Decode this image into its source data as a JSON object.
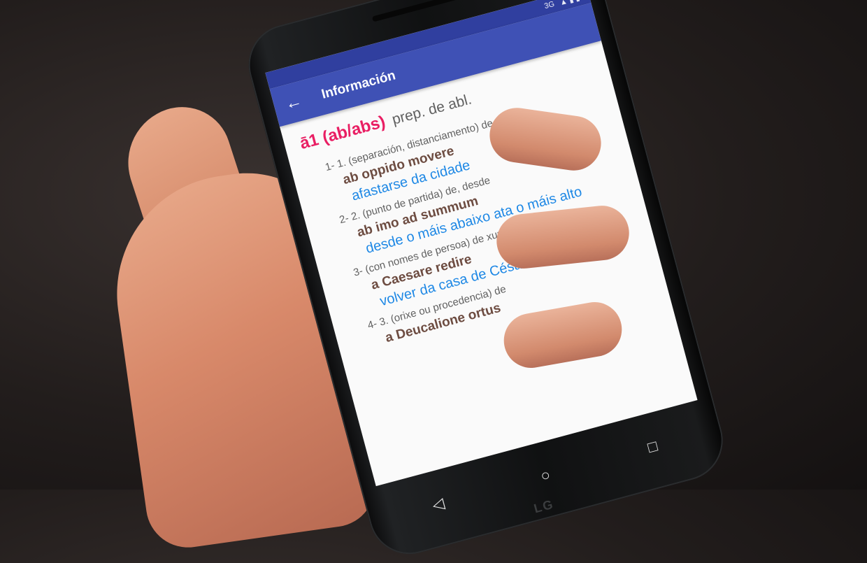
{
  "statusbar": {
    "network": "3G",
    "battery": "▲ ▮ ▮"
  },
  "appbar": {
    "back_icon": "arrow-left",
    "title": "Información"
  },
  "entry": {
    "headword": "ā1 (ab/abs)",
    "grammar": "prep. de abl.",
    "senses": [
      {
        "def": "1- 1. (separación, distanciamento) de",
        "latin": "ab oppido movere",
        "translation": "afastarse da cidade"
      },
      {
        "def": "2- 2. (punto de partida) de, desde",
        "latin": "ab imo ad summum",
        "translation": "desde o máis abaixo ata o máis alto"
      },
      {
        "def": "3- (con nomes de persoa) de xunto a, da casa de",
        "latin": "a Caesare redire",
        "translation": "volver da casa de César"
      },
      {
        "def": "4- 3. (orixe ou procedencia) de",
        "latin": "a Deucalione ortus",
        "translation": ""
      }
    ]
  },
  "navbar": {
    "back": "◁",
    "home": "○",
    "recents": "□"
  },
  "device": {
    "brand": "LG"
  },
  "colors": {
    "primary": "#3f51b5",
    "primary_dark": "#303f9f",
    "headword": "#e91e63",
    "latin": "#6d4c41",
    "translation": "#1e88e5"
  }
}
